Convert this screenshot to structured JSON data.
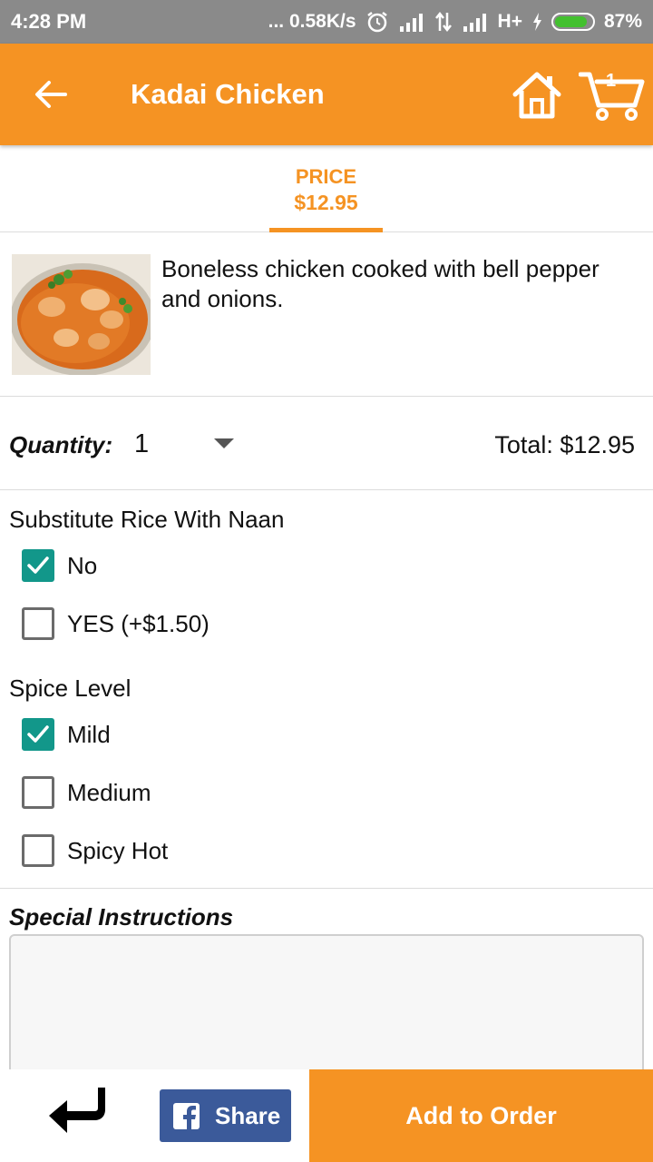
{
  "status_bar": {
    "time": "4:28 PM",
    "network_speed": "... 0.58K/s",
    "network_type": "H+",
    "battery": "87%",
    "battery_level": 0.87
  },
  "app_bar": {
    "title": "Kadai Chicken",
    "cart_count": "1",
    "back_icon": "arrow-left-icon",
    "home_icon": "home-icon",
    "cart_icon": "cart-icon"
  },
  "price_tab": {
    "label": "PRICE",
    "value": "$12.95"
  },
  "item": {
    "image_icon": "food-photo",
    "description": "Boneless chicken cooked with bell pepper and onions."
  },
  "quantity": {
    "label": "Quantity:",
    "value": "1",
    "total": "Total: $12.95"
  },
  "options": {
    "rice": {
      "title": "Substitute Rice With Naan",
      "choices": [
        {
          "label": "No",
          "checked": true
        },
        {
          "label": "YES (+$1.50)",
          "checked": false
        }
      ]
    },
    "spice": {
      "title": "Spice Level",
      "choices": [
        {
          "label": "Mild",
          "checked": true
        },
        {
          "label": "Medium",
          "checked": false
        },
        {
          "label": "Spicy Hot",
          "checked": false
        }
      ]
    }
  },
  "special_instructions": {
    "label": "Special Instructions",
    "value": ""
  },
  "bottom_bar": {
    "return_icon": "return-arrow-icon",
    "share_label": "Share",
    "share_icon": "facebook-icon",
    "add_label": "Add to Order"
  },
  "colors": {
    "accent": "#f59323",
    "checkbox": "#12978a",
    "facebook": "#3b5a9a",
    "status_bar": "#8a8a8a"
  }
}
